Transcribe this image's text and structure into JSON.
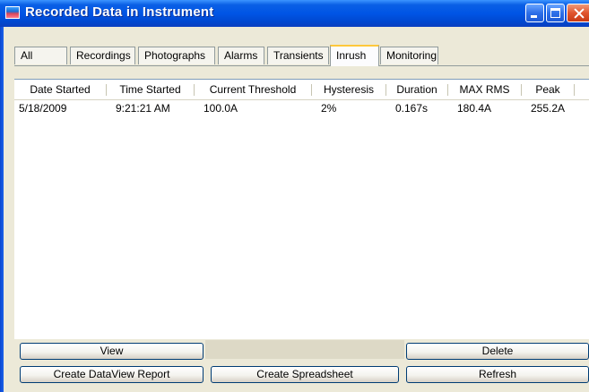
{
  "window": {
    "title": "Recorded Data in Instrument"
  },
  "tabs": [
    {
      "label": "All"
    },
    {
      "label": "Recordings"
    },
    {
      "label": "Photographs"
    },
    {
      "label": "Alarms"
    },
    {
      "label": "Transients"
    },
    {
      "label": "Inrush",
      "active": true
    },
    {
      "label": "Monitoring"
    }
  ],
  "table": {
    "columns": [
      "Date Started",
      "Time Started",
      "Current Threshold",
      "Hysteresis",
      "Duration",
      "MAX RMS",
      "Peak"
    ],
    "rows": [
      [
        "5/18/2009",
        "9:21:21 AM",
        "100.0A",
        "2%",
        "0.167s",
        "180.4A",
        "255.2A"
      ]
    ]
  },
  "buttons": {
    "view": "View",
    "delete": "Delete",
    "create_dataview_report": "Create DataView Report",
    "create_spreadsheet": "Create Spreadsheet",
    "refresh": "Refresh"
  },
  "colors": {
    "titlebar": "#0055e5",
    "active_tab_accent": "#ffc83c",
    "close_button": "#e0552e"
  }
}
